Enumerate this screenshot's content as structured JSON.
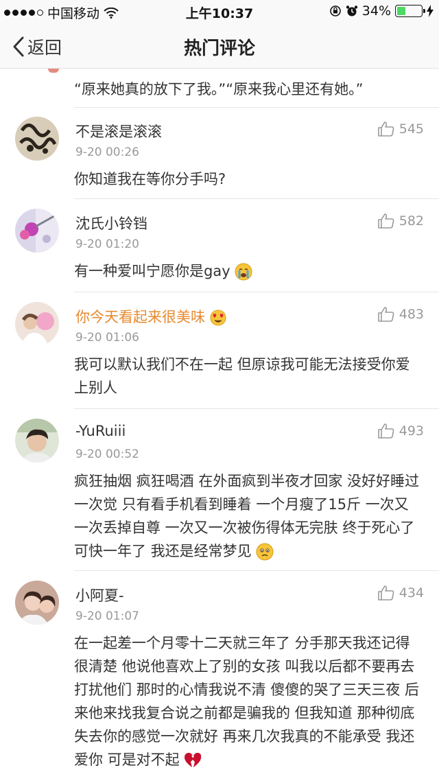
{
  "status_bar": {
    "carrier": "中国移动",
    "time": "上午10:37",
    "battery": "34%",
    "battery_level": 0.34
  },
  "nav": {
    "back_label": "返回",
    "title": "热门评论"
  },
  "top_comment_text": "“原来她真的放下了我。”“原来我心里还有她。”",
  "comments": [
    {
      "name": "不是滚是滚滚",
      "date": "9-20 00:26",
      "likes": "545",
      "text": "你知道我在等你分手吗?"
    },
    {
      "name": "沈氏小铃铛",
      "date": "9-20 01:20",
      "likes": "582",
      "text": "有一种爱叫宁愿你是gay"
    },
    {
      "name": "你今天看起来很美味",
      "date": "9-20 01:06",
      "likes": "483",
      "text": "我可以默认我们不在一起 但原谅我可能无法接受你爱上别人"
    },
    {
      "name": "-YuRuiii",
      "date": "9-20 00:52",
      "likes": "493",
      "text": "疯狂抽烟 疯狂喝酒 在外面疯到半夜才回家 没好好睡过一次觉 只有看手机看到睡着 一个月瘦了15斤 一次又一次丢掉自尊 一次又一次被伤得体无完肤 终于死心了 可快一年了 我还是经常梦见"
    },
    {
      "name": "小阿夏-",
      "date": "9-20 01:07",
      "likes": "434",
      "text": "在一起差一个月零十二天就三年了 分手那天我还记得很清楚 他说他喜欢上了别的女孩 叫我以后都不要再去打扰他们 那时的心情我说不清 傻傻的哭了三天三夜 后来他来找我复合说之前都是骗我的 但我知道 那种彻底失去你的感觉一次就好 再来几次我真的不能承受 我还爱你 可是对不起"
    }
  ]
}
